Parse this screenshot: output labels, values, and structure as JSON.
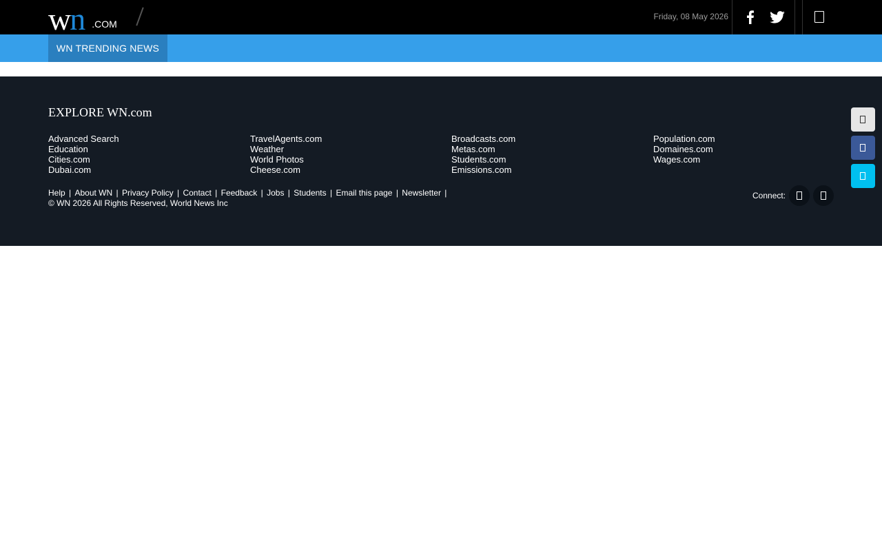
{
  "header": {
    "logo": {
      "w": "w",
      "n": "n",
      "com": ".COM"
    },
    "date": "Friday, 08 May 2026",
    "icons": [
      "facebook-icon",
      "twitter-icon",
      "menu-icon"
    ]
  },
  "nav": {
    "tab_label": "WN TRENDING NEWS"
  },
  "footer": {
    "explore_title": "EXPLORE WN.com",
    "columns": [
      [
        "Advanced Search",
        "Education",
        "Cities.com",
        "Dubai.com"
      ],
      [
        "TravelAgents.com",
        "Weather",
        "World Photos",
        "Cheese.com"
      ],
      [
        "Broadcasts.com",
        "Metas.com",
        "Students.com",
        "Emissions.com"
      ],
      [
        "Population.com",
        "Domaines.com",
        "Wages.com"
      ]
    ],
    "links": [
      "Help",
      "About WN",
      "Privacy Policy",
      "Contact",
      "Feedback",
      "Jobs",
      "Students",
      "Email this page",
      "Newsletter"
    ],
    "copyright": "© WN 2026 All Rights Reserved, World News Inc",
    "connect_label": "Connect:"
  },
  "colors": {
    "topbar": "#000000",
    "nav": "#369fea",
    "nav_tab": "#2a7fbf",
    "footer": "#141b24",
    "logo_accent": "#1e88d8",
    "share_gray": "#e6e6e6",
    "share_facebook": "#3b5998",
    "share_twitter": "#00c0f0"
  }
}
